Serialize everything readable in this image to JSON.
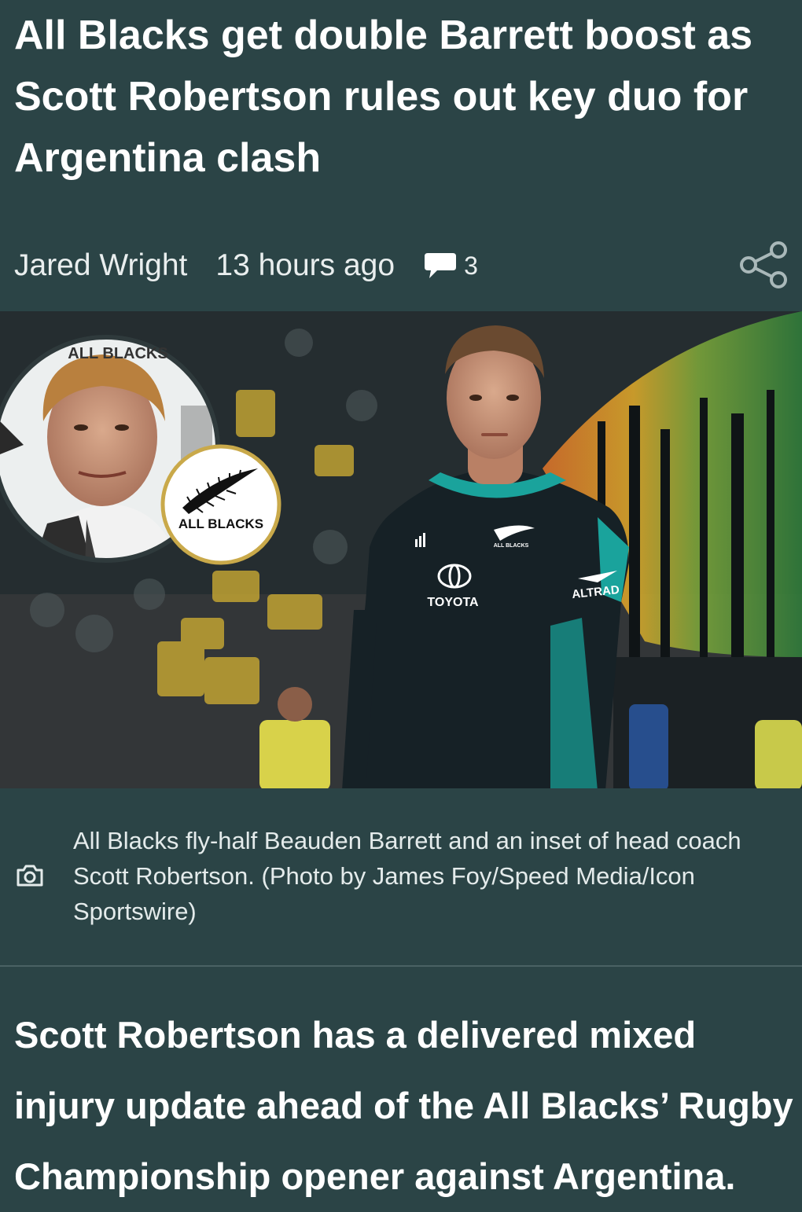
{
  "article": {
    "headline": "All Blacks get double Barrett boost as Scott Robertson rules out key duo for Argentina clash",
    "author": "Jared Wright",
    "published": "13 hours ago",
    "comment_count": "3",
    "image": {
      "badge_text": "ALL BLACKS",
      "sponsor_main": "TOYOTA",
      "sponsor_sleeve": "ALTRAD",
      "crest_text": "ALL BLACKS",
      "inset_banner_text": "ALL BLACKS"
    },
    "caption": "All Blacks fly-half Beauden Barrett and an inset of head coach Scott Robertson. (Photo by James Foy/Speed Media/Icon Sportswire)",
    "standfirst": "Scott Robertson has a delivered mixed injury update ahead of the All Blacks’ Rugby Championship opener against Argentina."
  },
  "icons": {
    "comment": "speech-bubble-icon",
    "share": "share-icon",
    "camera": "camera-icon"
  },
  "colors": {
    "background": "#2b4446",
    "text": "#ffffff",
    "jersey_teal": "#1aa39c"
  }
}
